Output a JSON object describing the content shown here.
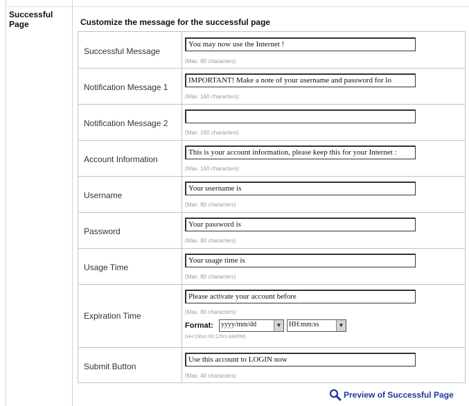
{
  "section_title": "Successful Page",
  "heading": "Customize the message for the successful page",
  "fields": [
    {
      "label": "Successful Message",
      "value": "You may now use the Internet !",
      "hint": "(Max. 80 characters)"
    },
    {
      "label": "Notification Message 1",
      "value": "IMPORTANT! Make a note of your username and password for lo",
      "hint": "(Max. 160 characters)"
    },
    {
      "label": "Notification Message 2",
      "value": "",
      "hint": "(Max. 160 characters)"
    },
    {
      "label": "Account Information",
      "value": "This is your account information, please keep this for your Internet :",
      "hint": "(Max. 160 characters)"
    },
    {
      "label": "Username",
      "value": "Your username is",
      "hint": "(Max. 80 characters)"
    },
    {
      "label": "Password",
      "value": "Your password is",
      "hint": "(Max. 80 characters)"
    },
    {
      "label": "Usage Time",
      "value": "Your usage time is",
      "hint": "(Max. 80 characters)"
    },
    {
      "label": "Expiration Time",
      "value": "Please activate your account before",
      "hint": "(Max. 80 characters)"
    },
    {
      "label": "Submit Button",
      "value": "Use this account to LOGIN now",
      "hint": "(Max. 40 characters)"
    }
  ],
  "expiration_format": {
    "label": "Format:",
    "date_value": "yyyy/mm/dd",
    "time_value": "HH:mm:ss",
    "note": "(HH:24hrs hh:12hrs AM/PM)"
  },
  "preview_link": "Preview of Successful Page",
  "colors": {
    "link": "#1a3a9a",
    "border": "#b8c8b8"
  }
}
